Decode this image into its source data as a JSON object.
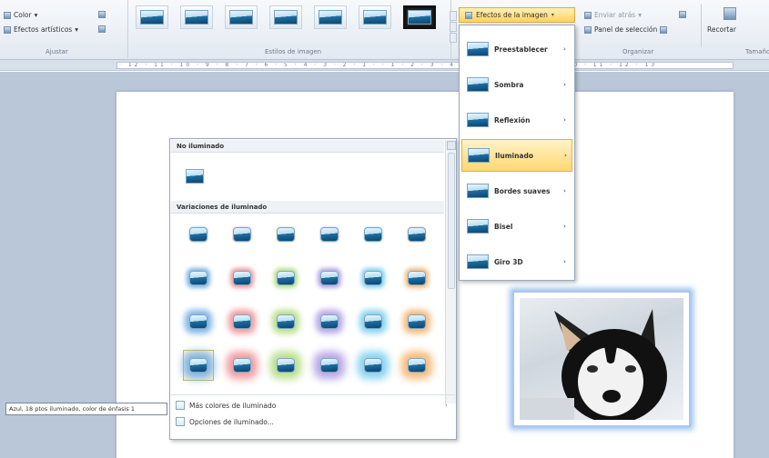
{
  "ribbon": {
    "adjust": {
      "color_label": "Color",
      "artistic_label": "Efectos artísticos",
      "group_label": "Ajustar"
    },
    "styles": {
      "group_label": "Estilos de imagen"
    },
    "effects_button_label": "Efectos de la imagen",
    "arrange": {
      "send_back_label": "Enviar atrás",
      "selection_pane_label": "Panel de selección",
      "group_label": "Organizar"
    },
    "crop": {
      "crop_label": "Recortar",
      "group_label": "Tamaño"
    }
  },
  "ruler": {
    "ticks": "· 12 · 11 · 10 · 9 · 8 · 7 · 6 · 5 · 4 · 3 · 2 · 1 · · 1 · 2 · 3 · 4 · 5 · 6 · 7 · 8 · 9 · 10 · 11 · 12 · 13"
  },
  "effects_menu": {
    "items": [
      {
        "label": "Preestablecer"
      },
      {
        "label": "Sombra"
      },
      {
        "label": "Reflexión"
      },
      {
        "label": "Iluminado"
      },
      {
        "label": "Bordes suaves"
      },
      {
        "label": "Bisel"
      },
      {
        "label": "Giro 3D"
      }
    ]
  },
  "glow_gallery": {
    "no_glow_heading": "No iluminado",
    "variations_heading": "Variaciones de iluminado",
    "glow_colors": [
      "#7fb4e6",
      "#f19aa0",
      "#b8df8a",
      "#b7a6e6",
      "#86d3f0",
      "#f5b97a"
    ],
    "more_colors_label": "Más colores de iluminado",
    "options_label": "Opciones de iluminado..."
  },
  "tooltip": {
    "text": "Azul, 18 ptos iluminado, color de énfasis 1"
  }
}
